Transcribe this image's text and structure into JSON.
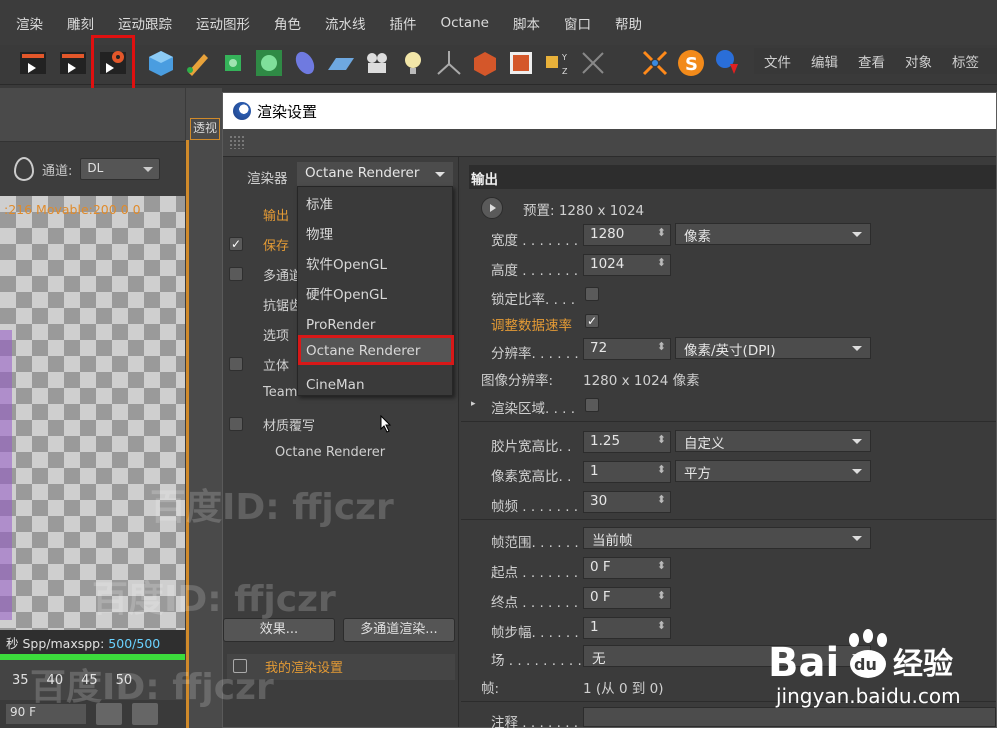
{
  "menubar": [
    "渲染",
    "雕刻",
    "运动跟踪",
    "运动图形",
    "角色",
    "流水线",
    "插件",
    "Octane",
    "脚本",
    "窗口",
    "帮助"
  ],
  "right_menu": [
    "文件",
    "编辑",
    "查看",
    "对象",
    "标签"
  ],
  "viewport": {
    "tab_label": "透视",
    "channel_label": "通道:",
    "channel_value": "DL",
    "info": ":216 Movable:200  0 0",
    "spp_prefix": "秒  Spp/maxspp: ",
    "spp_value": "500/500",
    "timeline_ticks": [
      "35",
      "40",
      "45",
      "50"
    ],
    "frame_field": "90 F"
  },
  "dialog": {
    "title": "渲染设置",
    "renderer_label": "渲染器",
    "renderer_value": "Octane Renderer",
    "renderer_options": [
      "标准",
      "物理",
      "软件OpenGL",
      "硬件OpenGL",
      "ProRender",
      "Octane Renderer",
      "CineMan"
    ],
    "tree": [
      {
        "text": "输出",
        "checked": false,
        "has_checkbox": false,
        "orange": true
      },
      {
        "text": "保存",
        "checked": true,
        "has_checkbox": true,
        "orange": true
      },
      {
        "text": "多通道",
        "checked": false,
        "has_checkbox": true,
        "orange": false
      },
      {
        "text": "抗锯齿",
        "checked": false,
        "has_checkbox": false,
        "orange": false
      },
      {
        "text": "选项",
        "checked": false,
        "has_checkbox": false,
        "orange": false
      },
      {
        "text": "立体",
        "checked": false,
        "has_checkbox": true,
        "orange": false
      },
      {
        "text": "Team Render",
        "checked": false,
        "has_checkbox": false,
        "orange": false
      },
      {
        "text": "材质覆写",
        "checked": false,
        "has_checkbox": true,
        "orange": false
      },
      {
        "text": "Octane Renderer",
        "checked": false,
        "has_checkbox": false,
        "orange": false
      }
    ],
    "effects_button": "效果...",
    "multipass_button": "多通道渲染...",
    "my_setting": "我的渲染设置"
  },
  "output": {
    "header": "输出",
    "preset": "预置: 1280 x 1024",
    "width_label": "宽度 . . . . . . . . .",
    "width_value": "1280",
    "unit_value": "像素",
    "height_label": "高度 . . . . . . . . .",
    "height_value": "1024",
    "lock_ratio_label": "锁定比率. . . .",
    "adjust_rate_label": "调整数据速率",
    "resolution_label": "分辨率. . . . . . .",
    "resolution_value": "72",
    "resolution_unit": "像素/英寸(DPI)",
    "image_res_label": "图像分辨率:",
    "image_res_value": "1280 x 1024 像素",
    "render_region_label": "渲染区域. . . .",
    "film_aspect_label": "胶片宽高比. .",
    "film_aspect_value": "1.25",
    "film_aspect_preset": "自定义",
    "pixel_aspect_label": "像素宽高比. .",
    "pixel_aspect_value": "1",
    "pixel_aspect_preset": "平方",
    "fps_label": "帧频 . . . . . . . . .",
    "fps_value": "30",
    "frame_range_label": "帧范围. . . . . . .",
    "frame_range_value": "当前帧",
    "start_label": "起点 . . . . . . . . .",
    "start_value": "0 F",
    "end_label": "终点 . . . . . . . . .",
    "end_value": "0 F",
    "step_label": "帧步幅. . . . . . .",
    "step_value": "1",
    "field_label": "场 . . . . . . . . . .",
    "field_value": "无",
    "frames_label": "帧:",
    "frames_value": "1 (从 0 到 0)",
    "notes_label": "注释 . . . . . . . . ."
  },
  "watermark": {
    "text": "百度ID: ffjczr",
    "baidu": "Bai  经验",
    "url": "jingyan.baidu.com"
  },
  "colors": {
    "accent_orange": "#e39a35",
    "highlight_red": "#d81818",
    "spp_blue": "#6ad2ff"
  }
}
